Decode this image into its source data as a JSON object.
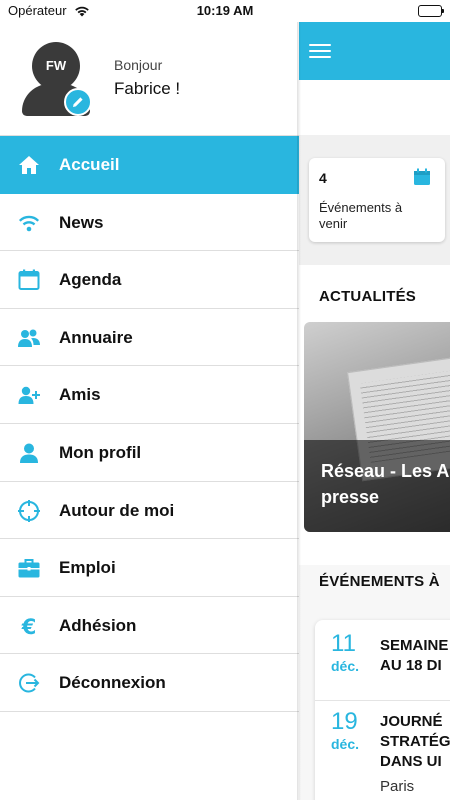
{
  "status_bar": {
    "carrier": "Opérateur",
    "time": "10:19 AM"
  },
  "profile": {
    "initials": "FW",
    "greeting": "Bonjour",
    "name": "Fabrice !"
  },
  "menu": {
    "items": [
      {
        "label": "Accueil",
        "icon": "home-icon",
        "active": true
      },
      {
        "label": "News",
        "icon": "wifi-icon",
        "active": false
      },
      {
        "label": "Agenda",
        "icon": "calendar-icon",
        "active": false
      },
      {
        "label": "Annuaire",
        "icon": "users-icon",
        "active": false
      },
      {
        "label": "Amis",
        "icon": "user-add-icon",
        "active": false
      },
      {
        "label": "Mon profil",
        "icon": "user-icon",
        "active": false
      },
      {
        "label": "Autour de moi",
        "icon": "crosshair-icon",
        "active": false
      },
      {
        "label": "Emploi",
        "icon": "briefcase-icon",
        "active": false
      },
      {
        "label": "Adhésion",
        "icon": "euro-icon",
        "active": false
      },
      {
        "label": "Déconnexion",
        "icon": "logout-icon",
        "active": false
      }
    ]
  },
  "main": {
    "events_card": {
      "count": "4",
      "label": "Événements à venir"
    },
    "news_section_title": "ACTUALITÉS",
    "news_card_title": "Réseau - Les A\npresse",
    "events_section_title": "ÉVÉNEMENTS À",
    "events": [
      {
        "day": "11",
        "month": "déc.",
        "title": "SEMAINE\nAU 18 DI",
        "place": ""
      },
      {
        "day": "19",
        "month": "déc.",
        "title": "JOURNÉ\nSTRATÉG\nDANS UI",
        "place": "Paris"
      }
    ]
  },
  "colors": {
    "accent": "#29b6df",
    "avatar": "#3a3a3a"
  }
}
